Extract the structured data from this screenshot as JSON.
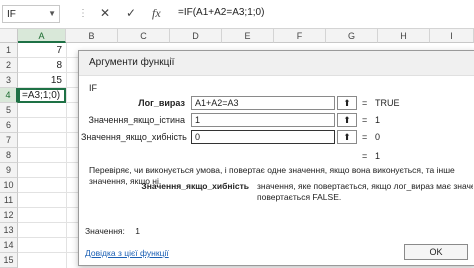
{
  "formula_bar": {
    "name_box": "IF",
    "cancel_icon": "✕",
    "enter_icon": "✓",
    "fx_icon": "fx",
    "formula": "=IF(A1+A2=A3;1;0)"
  },
  "sheet": {
    "columns": [
      "A",
      "B",
      "C",
      "D",
      "E",
      "F",
      "G",
      "H",
      "I"
    ],
    "rows": [
      "1",
      "2",
      "3",
      "4",
      "5",
      "6",
      "7",
      "8",
      "9",
      "10",
      "11",
      "12",
      "13",
      "14",
      "15"
    ],
    "cells": {
      "a1": "7",
      "a2": "8",
      "a3": "15",
      "a4": "=A3;1;0)"
    }
  },
  "dialog": {
    "title": "Аргументи функції",
    "function_name": "IF",
    "args": [
      {
        "label": "Лог_вираз",
        "value": "A1+A2=A3",
        "eq": "=",
        "result": "TRUE"
      },
      {
        "label": "Значення_якщо_істина",
        "value": "1",
        "eq": "=",
        "result": "1"
      },
      {
        "label": "Значення_якщо_хибність",
        "value": "0",
        "eq": "=",
        "result": "0"
      }
    ],
    "overall_eq": "=",
    "overall_result": "1",
    "description": "Перевіряє, чи виконується умова, і повертає одне значення, якщо вона виконується, та інше значення, якщо ні.",
    "arg_desc_name": "Значення_якщо_хибність",
    "arg_desc_line1": "значення, яке повертається, якщо лог_вираз має значення FALSE.",
    "arg_desc_line2": "повертається FALSE.",
    "value_label": "Значення:",
    "value": "1",
    "help_link": "Довідка з цієї функції",
    "ok_label": "OK"
  },
  "colors": {
    "accent_green": "#1e7145",
    "link_blue": "#1a5fb4"
  }
}
